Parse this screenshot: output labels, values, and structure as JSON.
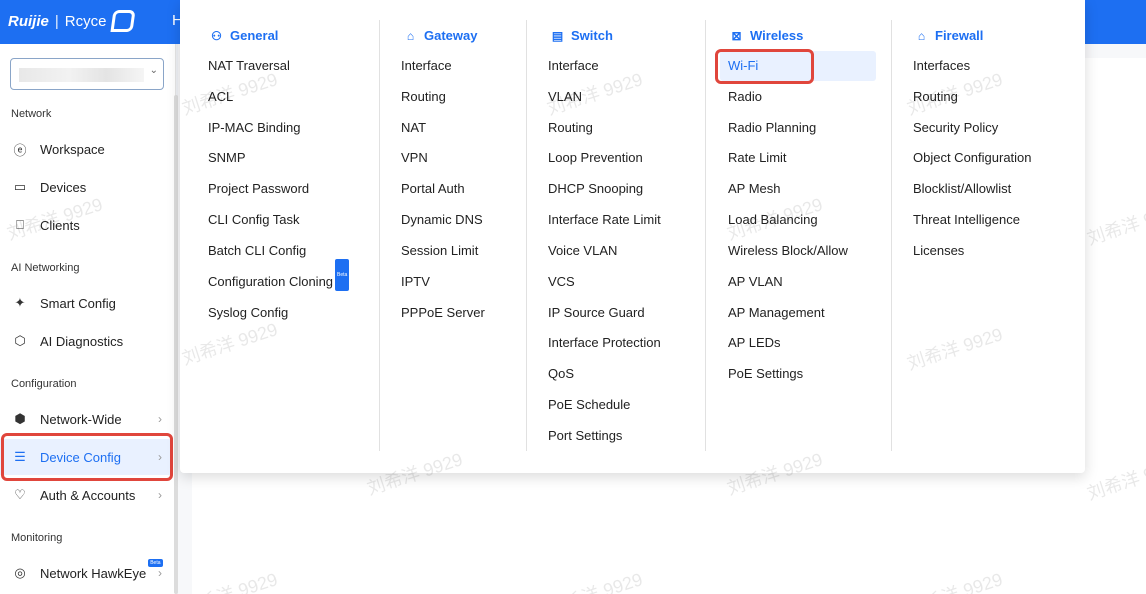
{
  "app": {
    "brand": "Ruijie",
    "brand_sub": "Rcyce",
    "header_fragment": "H"
  },
  "sidebar": {
    "sections": [
      {
        "label": "Network"
      },
      {
        "label": "AI Networking"
      },
      {
        "label": "Configuration"
      },
      {
        "label": "Monitoring"
      }
    ],
    "items": [
      {
        "label": "Workspace",
        "icon": "workspace-icon"
      },
      {
        "label": "Devices",
        "icon": "devices-icon"
      },
      {
        "label": "Clients",
        "icon": "clients-icon"
      },
      {
        "label": "Smart Config",
        "icon": "smart-config-icon"
      },
      {
        "label": "AI Diagnostics",
        "icon": "ai-diagnostics-icon"
      },
      {
        "label": "Network-Wide",
        "icon": "network-wide-icon"
      },
      {
        "label": "Device Config",
        "icon": "device-config-icon"
      },
      {
        "label": "Auth & Accounts",
        "icon": "auth-accounts-icon"
      },
      {
        "label": "Network HawkEye",
        "icon": "hawkeye-icon"
      }
    ],
    "beta_badge": "Beta"
  },
  "menu": {
    "columns": [
      {
        "title": "General",
        "icon": "general-icon",
        "items": [
          "NAT Traversal",
          "ACL",
          "IP-MAC Binding",
          "SNMP",
          "Project Password",
          "CLI Config Task",
          "Batch CLI Config",
          "Configuration Cloning",
          "Syslog Config"
        ]
      },
      {
        "title": "Gateway",
        "icon": "gateway-icon",
        "items": [
          "Interface",
          "Routing",
          "NAT",
          "VPN",
          "Portal Auth",
          "Dynamic DNS",
          "Session Limit",
          "IPTV",
          "PPPoE Server"
        ]
      },
      {
        "title": "Switch",
        "icon": "switch-icon",
        "items": [
          "Interface",
          "VLAN",
          "Routing",
          "Loop Prevention",
          "DHCP Snooping",
          "Interface Rate Limit",
          "Voice VLAN",
          "VCS",
          "IP Source Guard",
          "Interface Protection",
          "QoS",
          "PoE Schedule",
          "Port Settings"
        ]
      },
      {
        "title": "Wireless",
        "icon": "wireless-icon",
        "items": [
          "Wi-Fi",
          "Radio",
          "Radio Planning",
          "Rate Limit",
          "AP Mesh",
          "Load Balancing",
          "Wireless Block/Allow",
          "AP VLAN",
          "AP Management",
          "AP LEDs",
          "PoE Settings"
        ]
      },
      {
        "title": "Firewall",
        "icon": "firewall-icon",
        "items": [
          "Interfaces",
          "Routing",
          "Security Policy",
          "Object Configuration",
          "Blocklist/Allowlist",
          "Threat Intelligence",
          "Licenses"
        ]
      }
    ]
  },
  "watermark": "刘希洋 9929",
  "colors": {
    "accent": "#1d6ff2",
    "highlight": "#e0463c"
  }
}
